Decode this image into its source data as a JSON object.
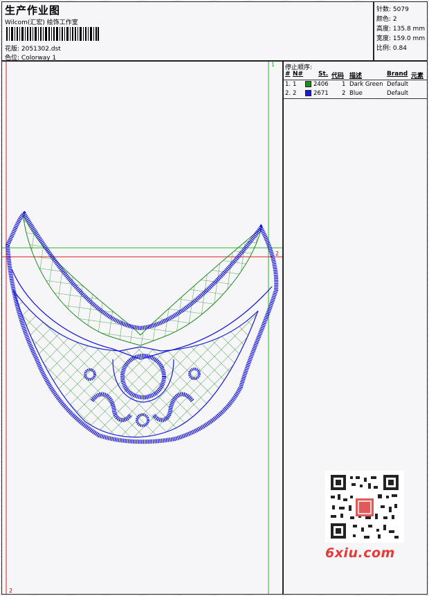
{
  "header": {
    "title": "生产作业图",
    "subtitle": "Wilcom(汇宏) 绘饰工作室",
    "design_file_label": "花版:",
    "design_file": "2051302.dst",
    "colorway_label": "色位:",
    "colorway": "Colorway 1"
  },
  "stats": [
    {
      "label": "针数:",
      "value": "5079"
    },
    {
      "label": "颜色:",
      "value": "2"
    },
    {
      "label": "高度:",
      "value": "135.8 mm"
    },
    {
      "label": "宽度:",
      "value": "159.0 mm"
    },
    {
      "label": "比例:",
      "value": "0.84"
    }
  ],
  "stop_sequence": {
    "title": "停止顺序:",
    "columns": [
      "#",
      "N#",
      "St.",
      "代码",
      "描述",
      "Brand",
      "元素"
    ],
    "rows": [
      {
        "index": "1.",
        "needle": "1",
        "code": "2406",
        "stop": "1",
        "description": "Dark Green",
        "brand": "Default",
        "color": "#1e8c1e"
      },
      {
        "index": "2.",
        "needle": "2",
        "code": "2671",
        "stop": "2",
        "description": "Blue",
        "brand": "Default",
        "color": "#1a1ad6"
      }
    ]
  },
  "guides": {
    "vertical_marker": "1",
    "horizontal_marker": "2",
    "bottom_marker": "2"
  },
  "colors": {
    "green_thread": "#1e8c1e",
    "blue_thread": "#1a1ad6",
    "guide_red": "#e02020",
    "guide_green": "#22bb22"
  },
  "watermark": "6xiu.com"
}
